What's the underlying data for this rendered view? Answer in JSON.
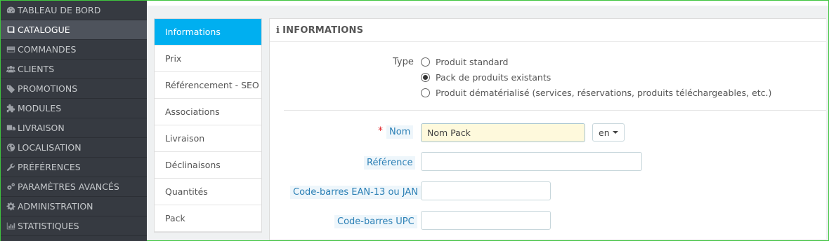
{
  "sidebar": {
    "items": [
      {
        "label": "TABLEAU DE BORD",
        "icon": "dashboard-icon"
      },
      {
        "label": "CATALOGUE",
        "icon": "book-icon",
        "active": true
      },
      {
        "label": "COMMANDES",
        "icon": "credit-card-icon"
      },
      {
        "label": "CLIENTS",
        "icon": "users-icon"
      },
      {
        "label": "PROMOTIONS",
        "icon": "tag-icon"
      },
      {
        "label": "MODULES",
        "icon": "puzzle-icon"
      },
      {
        "label": "LIVRAISON",
        "icon": "truck-icon"
      },
      {
        "label": "LOCALISATION",
        "icon": "globe-icon"
      },
      {
        "label": "PRÉFÉRENCES",
        "icon": "wrench-icon"
      },
      {
        "label": "PARAMÈTRES AVANCÉS",
        "icon": "cogs-icon"
      },
      {
        "label": "ADMINISTRATION",
        "icon": "gear-icon"
      },
      {
        "label": "STATISTIQUES",
        "icon": "bar-chart-icon"
      }
    ]
  },
  "tabs": [
    {
      "label": "Informations",
      "active": true
    },
    {
      "label": "Prix"
    },
    {
      "label": "Référencement - SEO"
    },
    {
      "label": "Associations"
    },
    {
      "label": "Livraison"
    },
    {
      "label": "Déclinaisons"
    },
    {
      "label": "Quantités"
    },
    {
      "label": "Pack"
    }
  ],
  "panel": {
    "heading": "INFORMATIONS",
    "type_label": "Type",
    "type_options": [
      {
        "label": "Produit standard",
        "checked": false
      },
      {
        "label": "Pack de produits existants",
        "checked": true
      },
      {
        "label": "Produit dématérialisé (services, réservations, produits téléchargeables, etc.)",
        "checked": false
      }
    ],
    "required_mark": "*",
    "fields": {
      "name": {
        "label": "Nom",
        "value": "Nom Pack",
        "lang": "en"
      },
      "reference": {
        "label": "Référence",
        "value": ""
      },
      "ean13": {
        "label": "Code-barres EAN-13 ou JAN",
        "value": ""
      },
      "upc": {
        "label": "Code-barres UPC",
        "value": ""
      }
    }
  },
  "colors": {
    "sidebar_bg": "#363a41",
    "sidebar_active": "#4e535c",
    "tab_active": "#00aff0",
    "label_color": "#2a7fb5",
    "required": "#e1242a"
  }
}
